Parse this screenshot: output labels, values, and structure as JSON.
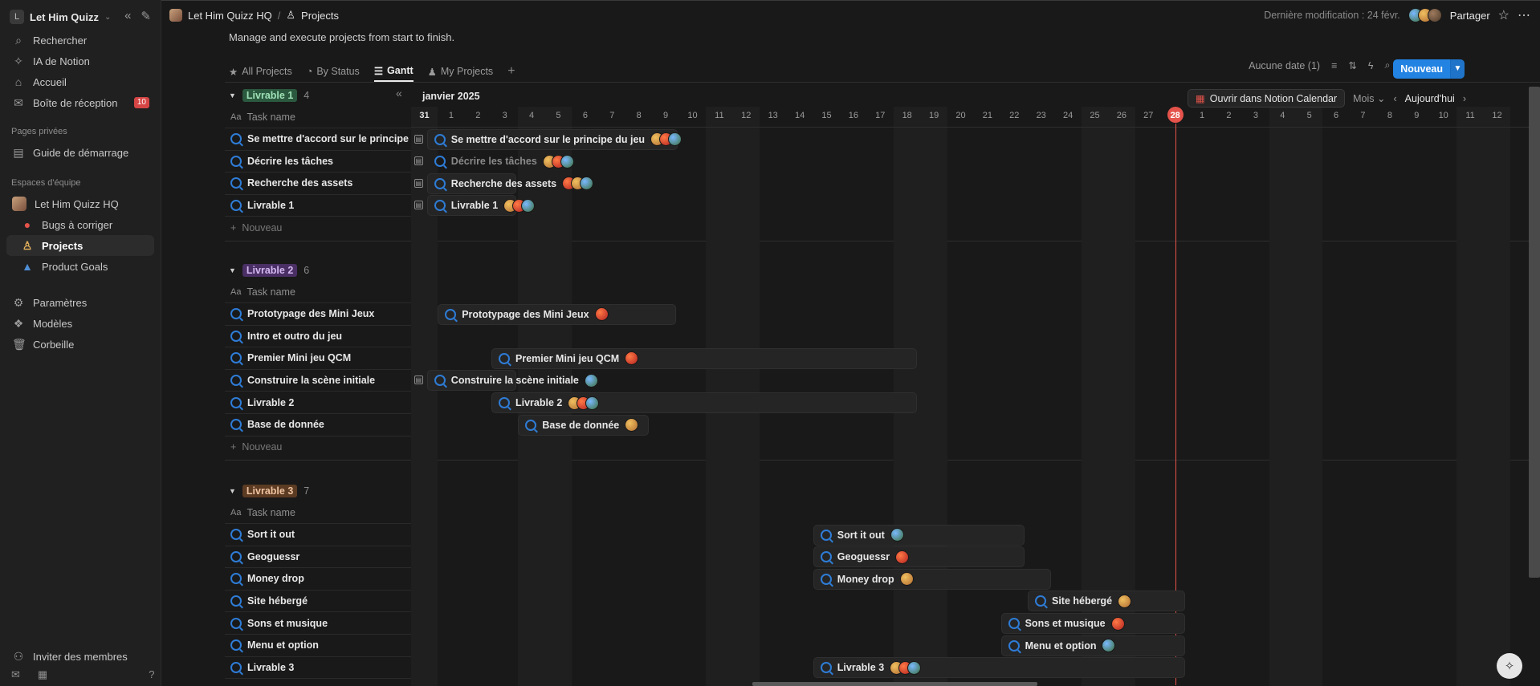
{
  "sidebar": {
    "workspace": "Let Him Quizz",
    "workspace_initial": "L",
    "items": [
      {
        "label": "Rechercher",
        "icon": "search-icon",
        "glyph": "⌕"
      },
      {
        "label": "IA de Notion",
        "icon": "ai-icon",
        "glyph": "✧"
      },
      {
        "label": "Accueil",
        "icon": "home-icon",
        "glyph": "⌂"
      },
      {
        "label": "Boîte de réception",
        "icon": "inbox-icon",
        "glyph": "✉",
        "badge": "10"
      }
    ],
    "section_private": "Pages privées",
    "private_items": [
      {
        "label": "Guide de démarrage",
        "icon": "page-icon",
        "glyph": "▤"
      }
    ],
    "section_team": "Espaces d'équipe",
    "team": {
      "label": "Let Him Quizz HQ"
    },
    "team_items": [
      {
        "label": "Bugs à corriger",
        "icon": "bug-icon",
        "glyph": "●"
      },
      {
        "label": "Projects",
        "icon": "projects-icon",
        "glyph": "♙"
      },
      {
        "label": "Product Goals",
        "icon": "goals-icon",
        "glyph": "▲"
      }
    ],
    "bottom_items": [
      {
        "label": "Paramètres",
        "icon": "settings-icon",
        "glyph": "⚙"
      },
      {
        "label": "Modèles",
        "icon": "templates-icon",
        "glyph": "❖"
      },
      {
        "label": "Corbeille",
        "icon": "trash-icon",
        "glyph": "🗑"
      }
    ],
    "invite": "Inviter des membres"
  },
  "topbar": {
    "breadcrumb_workspace": "Let Him Quizz HQ",
    "breadcrumb_sep": "/",
    "breadcrumb_page": "Projects",
    "last_modified": "Dernière modification : 24 févr.",
    "share": "Partager"
  },
  "page": {
    "description": "Manage and execute projects from start to finish.",
    "tabs": [
      {
        "label": "All Projects",
        "icon": "star-icon",
        "glyph": "★"
      },
      {
        "label": "By Status",
        "icon": "status-icon",
        "glyph": "◔"
      },
      {
        "label": "Gantt",
        "icon": "gantt-icon",
        "glyph": "☰",
        "active": true
      },
      {
        "label": "My Projects",
        "icon": "person-icon",
        "glyph": "♟"
      }
    ],
    "no_date": "Aucune date (1)",
    "new_button": "Nouveau"
  },
  "table": {
    "task_header": "Task name",
    "aa": "Aa",
    "new_row": "Nouveau",
    "groups": [
      {
        "name": "Livrable 1",
        "count": "4",
        "color": "#2b593f",
        "text_color": "#9ee0b5",
        "tasks": [
          "Se mettre d'accord sur le principe du jeu",
          "Décrire les tâches",
          "Recherche des assets",
          "Livrable 1"
        ]
      },
      {
        "name": "Livrable 2",
        "count": "6",
        "color": "#492f64",
        "text_color": "#d4b8f0",
        "tasks": [
          "Prototypage des Mini Jeux",
          "Intro et outro du jeu",
          "Premier Mini jeu QCM",
          "Construire la scène initiale",
          "Livrable 2",
          "Base de donnée"
        ]
      },
      {
        "name": "Livrable 3",
        "count": "7",
        "color": "#5c3b23",
        "text_color": "#f0c3a0",
        "tasks": [
          "Sort it out",
          "Geoguessr",
          "Money drop",
          "Site hébergé",
          "Sons et musique",
          "Menu et option",
          "Livrable 3"
        ]
      }
    ]
  },
  "gantt": {
    "month": "janvier 2025",
    "days": [
      "31",
      "1",
      "2",
      "3",
      "4",
      "5",
      "6",
      "7",
      "8",
      "9",
      "10",
      "11",
      "12",
      "13",
      "14",
      "15",
      "16",
      "17",
      "18",
      "19",
      "20",
      "21",
      "22",
      "23",
      "24",
      "25",
      "26",
      "27",
      "28",
      "1",
      "2",
      "3",
      "4",
      "5",
      "6",
      "7",
      "8",
      "9",
      "10",
      "11",
      "12"
    ],
    "today": "28",
    "open_calendar": "Ouvrir dans Notion Calendar",
    "scale": "Mois",
    "today_btn": "Aujourd'hui",
    "bars": [
      {
        "label": "Se mettre d'accord sur le principe du jeu",
        "avatars": [
          "a1",
          "a2",
          "a3"
        ]
      },
      {
        "label": "Décrire les tâches",
        "avatars": [
          "a1",
          "a2",
          "a3"
        ]
      },
      {
        "label": "Recherche des assets",
        "avatars": [
          "a2",
          "a1",
          "a3"
        ]
      },
      {
        "label": "Livrable 1",
        "avatars": [
          "a1",
          "a2",
          "a3"
        ]
      },
      {
        "label": "Prototypage des Mini Jeux",
        "avatars": [
          "a2"
        ]
      },
      {
        "label": "Premier Mini jeu QCM",
        "avatars": [
          "a2"
        ]
      },
      {
        "label": "Construire la scène initiale",
        "avatars": [
          "a3"
        ]
      },
      {
        "label": "Livrable 2",
        "avatars": [
          "a1",
          "a2",
          "a3"
        ]
      },
      {
        "label": "Base de donnée",
        "avatars": [
          "a1"
        ]
      },
      {
        "label": "Sort it out",
        "avatars": [
          "a3"
        ]
      },
      {
        "label": "Geoguessr",
        "avatars": [
          "a2"
        ]
      },
      {
        "label": "Money drop",
        "avatars": [
          "a1"
        ]
      },
      {
        "label": "Site hébergé",
        "avatars": [
          "a1"
        ]
      },
      {
        "label": "Sons et musique",
        "avatars": [
          "a2"
        ]
      },
      {
        "label": "Menu et option",
        "avatars": [
          "a3"
        ]
      },
      {
        "label": "Livrable 3",
        "avatars": [
          "a1",
          "a2",
          "a3"
        ]
      }
    ]
  }
}
